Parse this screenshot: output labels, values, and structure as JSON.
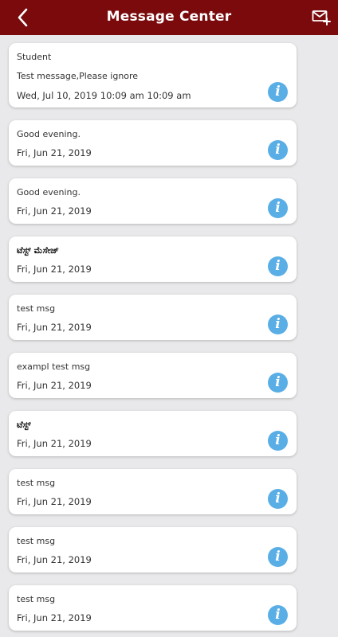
{
  "header": {
    "title": "Message Center",
    "back_icon": "chevron-left-icon",
    "compose_icon": "mail-plus-icon",
    "color": "#7a0a0c"
  },
  "info_icon": "info-icon",
  "accent_color": "#5aaee6",
  "messages": [
    {
      "lines": [
        "Student",
        "Test message,Please ignore"
      ],
      "bold": false,
      "date": "Wed, Jul 10, 2019 10:09 am 10:09 am"
    },
    {
      "lines": [
        "Good evening."
      ],
      "bold": false,
      "date": "Fri, Jun 21, 2019"
    },
    {
      "lines": [
        "Good evening."
      ],
      "bold": false,
      "date": "Fri, Jun 21, 2019"
    },
    {
      "lines": [
        "ಟೆಸ್ಟ್ ಮೆಸೇಜ್"
      ],
      "bold": true,
      "date": "Fri, Jun 21, 2019"
    },
    {
      "lines": [
        "test msg"
      ],
      "bold": false,
      "date": "Fri, Jun 21, 2019"
    },
    {
      "lines": [
        "exampl test msg"
      ],
      "bold": false,
      "date": "Fri, Jun 21, 2019"
    },
    {
      "lines": [
        "ಟೆಸ್ಟ್"
      ],
      "bold": true,
      "date": "Fri, Jun 21, 2019"
    },
    {
      "lines": [
        "test msg"
      ],
      "bold": false,
      "date": "Fri, Jun 21, 2019"
    },
    {
      "lines": [
        "test msg"
      ],
      "bold": false,
      "date": "Fri, Jun 21, 2019"
    },
    {
      "lines": [
        "test msg"
      ],
      "bold": false,
      "date": "Fri, Jun 21, 2019"
    }
  ]
}
